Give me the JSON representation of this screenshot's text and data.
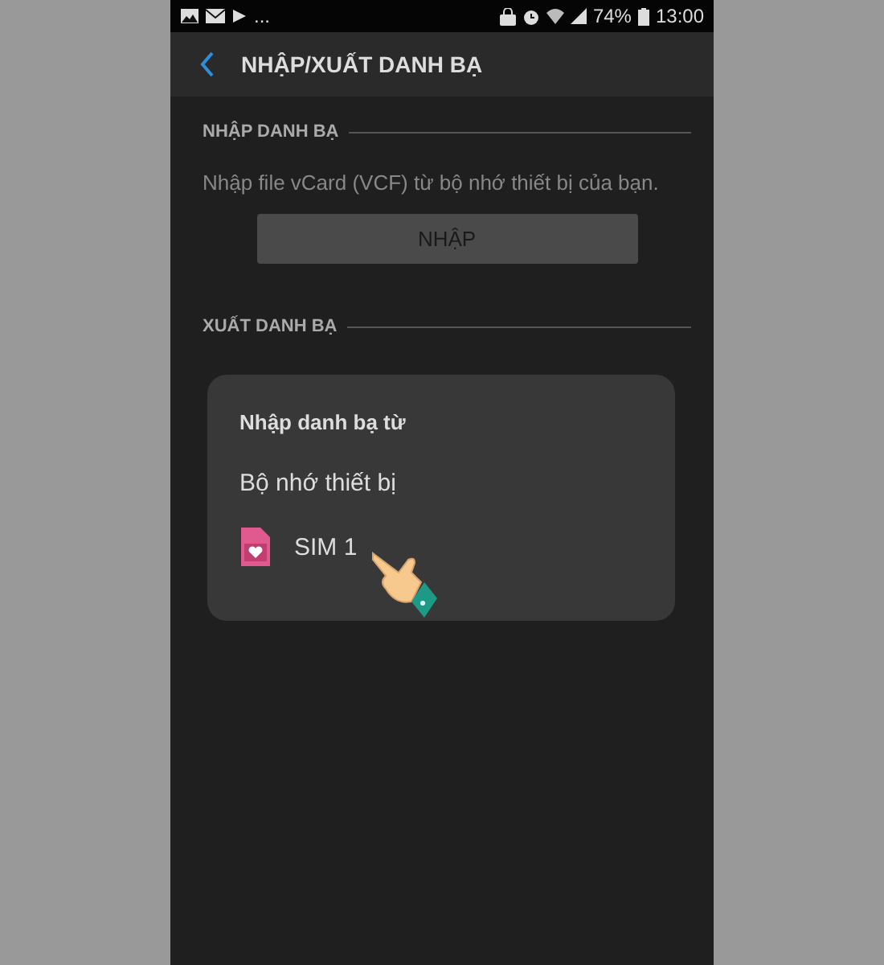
{
  "status_bar": {
    "more": "...",
    "battery": "74%",
    "time": "13:00"
  },
  "app_bar": {
    "title": "NHẬP/XUẤT DANH BẠ"
  },
  "sections": [
    {
      "header": "NHẬP DANH BẠ",
      "description": "Nhập file vCard (VCF) từ bộ nhớ thiết bị của bạn.",
      "button": {
        "label": "NHẬP",
        "disabled": true
      }
    },
    {
      "header": "XUẤT DANH BẠ"
    }
  ],
  "dialog": {
    "title": "Nhập danh bạ từ",
    "options": [
      {
        "kind": "text",
        "label": "Bộ nhớ thiết bị"
      },
      {
        "kind": "sim",
        "label": "SIM 1"
      }
    ]
  }
}
